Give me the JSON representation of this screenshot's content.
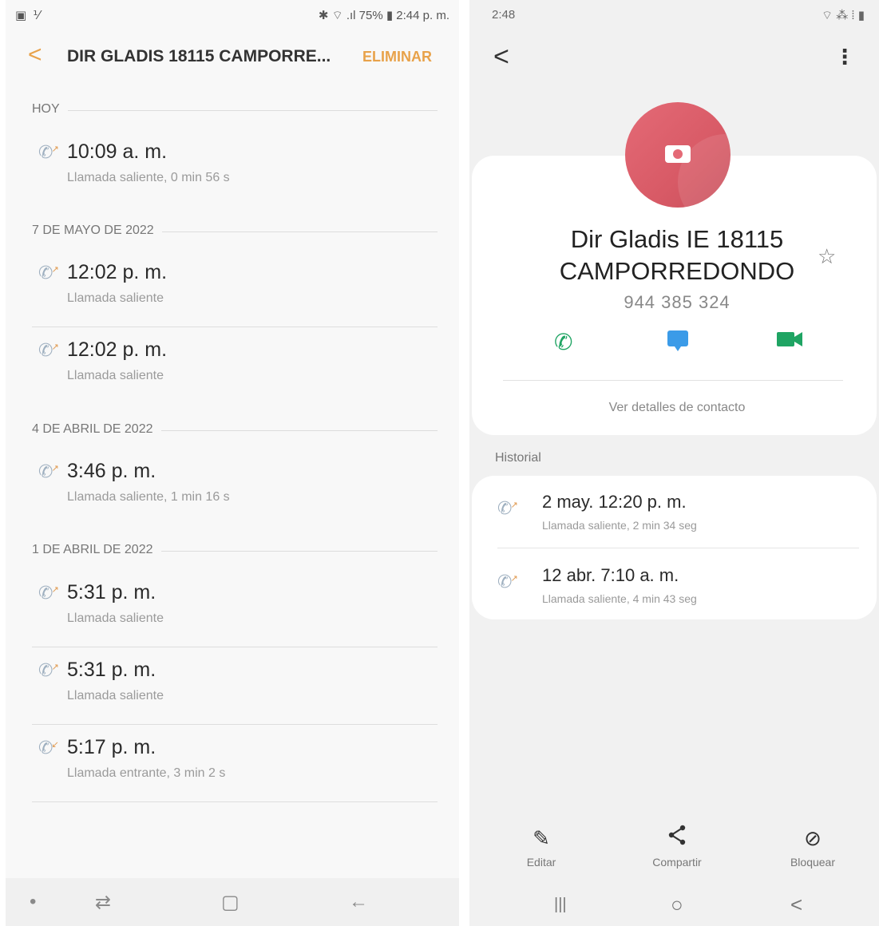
{
  "left": {
    "status": {
      "left": "▣ ⅟",
      "right": "✱ ⌔ .ıl 75% ▮ 2:44 p. m."
    },
    "header": {
      "back": "<",
      "title": "DIR GLADIS 18115 CAMPORRE...",
      "delete_label": "ELIMINAR"
    },
    "sections": [
      {
        "label": "HOY",
        "entries": [
          {
            "time": "10:09 a. m.",
            "detail": "Llamada saliente, 0 min 56 s"
          }
        ]
      },
      {
        "label": "7 DE MAYO DE 2022",
        "entries": [
          {
            "time": "12:02 p. m.",
            "detail": "Llamada saliente"
          },
          {
            "time": "12:02 p. m.",
            "detail": "Llamada saliente"
          }
        ]
      },
      {
        "label": "4 DE ABRIL DE 2022",
        "entries": [
          {
            "time": "3:46 p. m.",
            "detail": "Llamada saliente, 1 min 16 s"
          }
        ]
      },
      {
        "label": "1 DE ABRIL DE 2022",
        "entries": [
          {
            "time": "5:31 p. m.",
            "detail": "Llamada saliente"
          },
          {
            "time": "5:31 p. m.",
            "detail": "Llamada saliente"
          },
          {
            "time": "5:17 p. m.",
            "detail": "Llamada entrante, 3 min 2 s"
          }
        ]
      }
    ],
    "nav": {
      "dot": "•",
      "recents": "⇄",
      "home": "▢",
      "back": "←"
    }
  },
  "right": {
    "status": {
      "left": "2:48",
      "right": "⌔ ⁂ ⁞ ▮"
    },
    "back": "<",
    "more": "⋮",
    "contact": {
      "name_line1": "Dir Gladis IE 18115",
      "name_line2": "CAMPORREDONDO",
      "phone": "944 385 324",
      "star": "☆",
      "details_link": "Ver detalles de contacto"
    },
    "actions": {
      "call": "✆",
      "message": "▪",
      "video": "■"
    },
    "history": {
      "label": "Historial",
      "items": [
        {
          "time": "2 may. 12:20 p. m.",
          "detail": "Llamada saliente, 2 min 34 seg"
        },
        {
          "time": "12 abr. 7:10 a. m.",
          "detail": "Llamada saliente, 4 min 43 seg"
        }
      ]
    },
    "bottom_actions": [
      {
        "icon": "✎",
        "label": "Editar"
      },
      {
        "icon": "<",
        "label": "Compartir"
      },
      {
        "icon": "⊘",
        "label": "Bloquear"
      }
    ],
    "nav": {
      "recents": "|||",
      "home": "○",
      "back": "<"
    }
  },
  "colors": {
    "accent": "#e8a24a",
    "avatar": "#e46a76",
    "call": "#1fa463",
    "message": "#3b9be8",
    "video": "#1fa463"
  }
}
